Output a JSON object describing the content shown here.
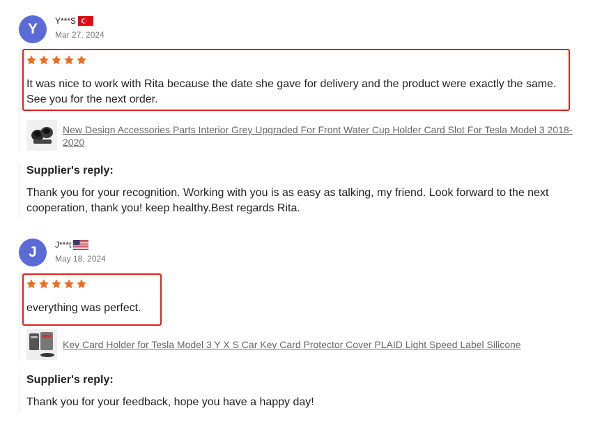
{
  "reviews": [
    {
      "avatar_letter": "Y",
      "avatar_color": "#5b6bd6",
      "name": "Y***S",
      "country": "Turkey",
      "date": "Mar 27, 2024",
      "rating": 5,
      "text": "It was nice to work with Rita because the date she gave for delivery and the product were exactly the same. See you for the next order.",
      "product_title": "New Design Accessories Parts Interior Grey Upgraded For Front Water Cup Holder Card Slot For Tesla Model 3 2018-2020",
      "reply_label": "Supplier's reply:",
      "reply_text": "Thank you for your recognition. Working with you is as easy as talking, my friend. Look forward to the next cooperation, thank you! keep healthy.Best regards Rita."
    },
    {
      "avatar_letter": "J",
      "avatar_color": "#5b6bd6",
      "name": "J***t",
      "country": "United States",
      "date": "May 18, 2024",
      "rating": 5,
      "text": "everything was perfect.",
      "product_title": "Key Card Holder for Tesla Model 3 Y X S Car Key Card Protector Cover PLAID Light Speed Label Silicone",
      "reply_label": "Supplier's reply:",
      "reply_text": "Thank you for your feedback, hope you have a happy day!"
    }
  ],
  "colors": {
    "star": "#f06a1e",
    "highlight_border": "#e02020",
    "link": "#666666"
  }
}
